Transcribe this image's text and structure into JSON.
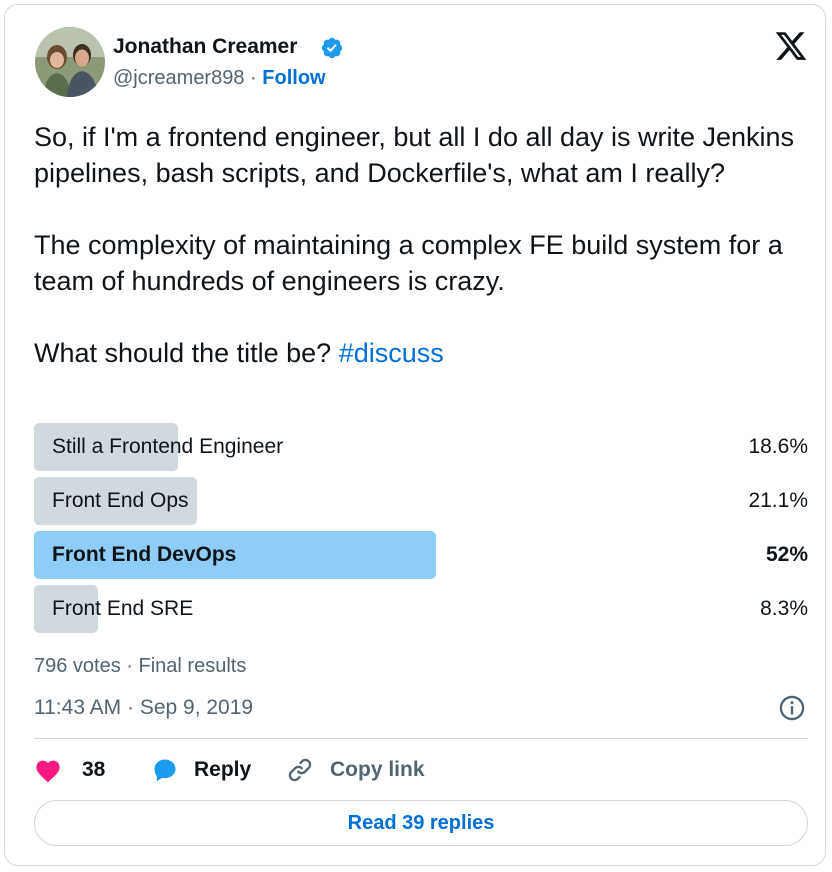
{
  "author": {
    "name": "Jonathan Creamer",
    "handle": "@jcreamer898",
    "separator": "·",
    "follow_label": "Follow"
  },
  "tweet": {
    "paragraphs": [
      "So, if I'm a frontend engineer, but all I do all day is write Jenkins pipelines, bash scripts, and Dockerfile's, what am I really?",
      "The complexity of maintaining a complex FE build system for a team of hundreds of engineers is crazy."
    ],
    "question": "What should the title be? ",
    "hashtag": "#discuss"
  },
  "poll": {
    "options": [
      {
        "label": "Still a Frontend Engineer",
        "percent_text": "18.6%",
        "percent": 18.6,
        "winner": false
      },
      {
        "label": "Front End Ops",
        "percent_text": "21.1%",
        "percent": 21.1,
        "winner": false
      },
      {
        "label": "Front End DevOps",
        "percent_text": "52%",
        "percent": 52,
        "winner": true
      },
      {
        "label": "Front End SRE",
        "percent_text": "8.3%",
        "percent": 8.3,
        "winner": false
      }
    ],
    "summary": "796 votes · Final results"
  },
  "timestamp": "11:43 AM · Sep 9, 2019",
  "actions": {
    "likes_count": "38",
    "reply_label": "Reply",
    "copy_link_label": "Copy link"
  },
  "read_replies_label": "Read 39 replies",
  "colors": {
    "accent": "#006fd6",
    "verified": "#1d9bf0",
    "like": "#f91880",
    "reply": "#1d9bf0",
    "poll_bar": "#cfd9de",
    "poll_winner": "#8ecdf8",
    "muted": "#536471"
  },
  "icons": [
    "avatar",
    "verified-badge-icon",
    "x-logo-icon",
    "info-icon",
    "heart-icon",
    "reply-bubble-icon",
    "link-icon"
  ]
}
